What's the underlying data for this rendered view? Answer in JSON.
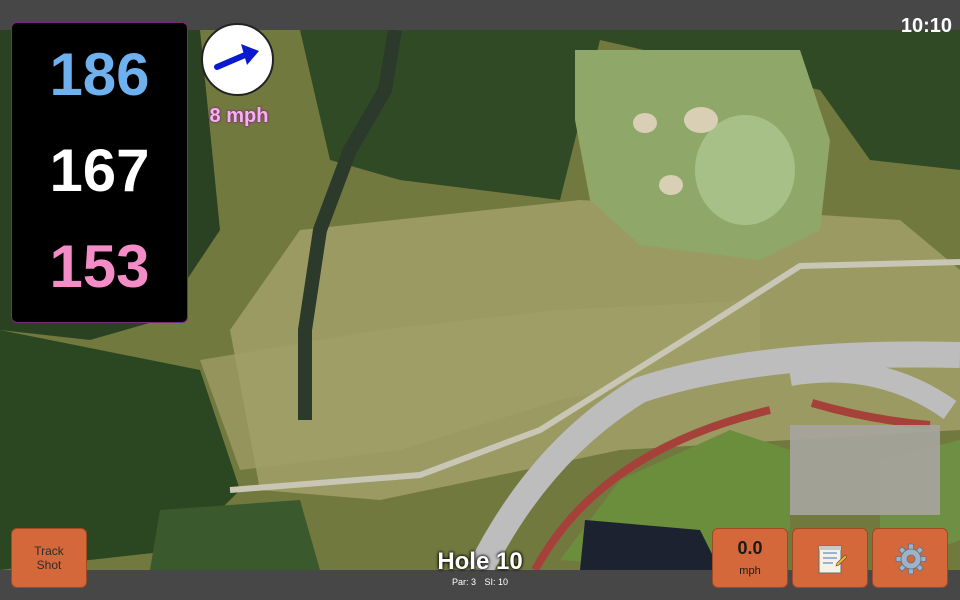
{
  "status_bar": {
    "time": "10:10"
  },
  "distances": {
    "back": "186",
    "middle": "167",
    "front": "153"
  },
  "wind": {
    "speed_label": "8 mph",
    "direction_icon": "arrow-up-right-icon"
  },
  "hole": {
    "title": "Hole 10",
    "par": "Par: 3",
    "stroke_index": "SI: 10"
  },
  "buttons": {
    "track_shot": {
      "line1": "Track",
      "line2": "Shot"
    },
    "wind_display": {
      "value": "0.0",
      "unit": "mph"
    },
    "notes": {
      "icon": "notepad-icon"
    },
    "settings": {
      "icon": "gear-icon"
    }
  },
  "colors": {
    "back_distance": "#6fb1ee",
    "middle_distance": "#ffffff",
    "front_distance": "#f48cc7",
    "button_orange": "#d4683a",
    "wind_label": "#f6b1ee"
  }
}
